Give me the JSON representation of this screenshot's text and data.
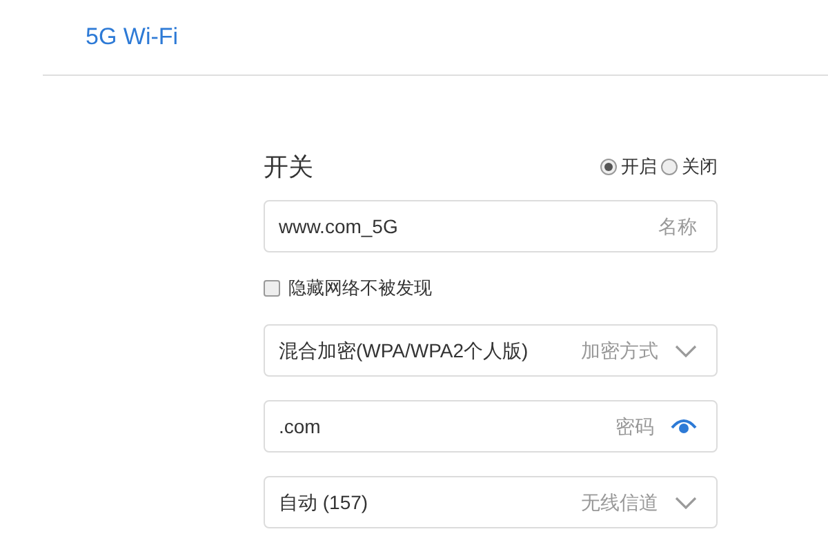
{
  "title": "5G Wi-Fi",
  "switch": {
    "label": "开关",
    "options": [
      {
        "label": "开启",
        "selected": true
      },
      {
        "label": "关闭",
        "selected": false
      }
    ]
  },
  "name_field": {
    "value": "www.com_5G",
    "label": "名称"
  },
  "hide_network": {
    "label": "隐藏网络不被发现",
    "checked": false
  },
  "fields": [
    {
      "kind": "select",
      "value": "混合加密(WPA/WPA2个人版)",
      "label": "加密方式"
    },
    {
      "kind": "password",
      "value": ".com",
      "label": "密码"
    },
    {
      "kind": "select",
      "value": "自动 (157)",
      "label": "无线信道"
    }
  ]
}
